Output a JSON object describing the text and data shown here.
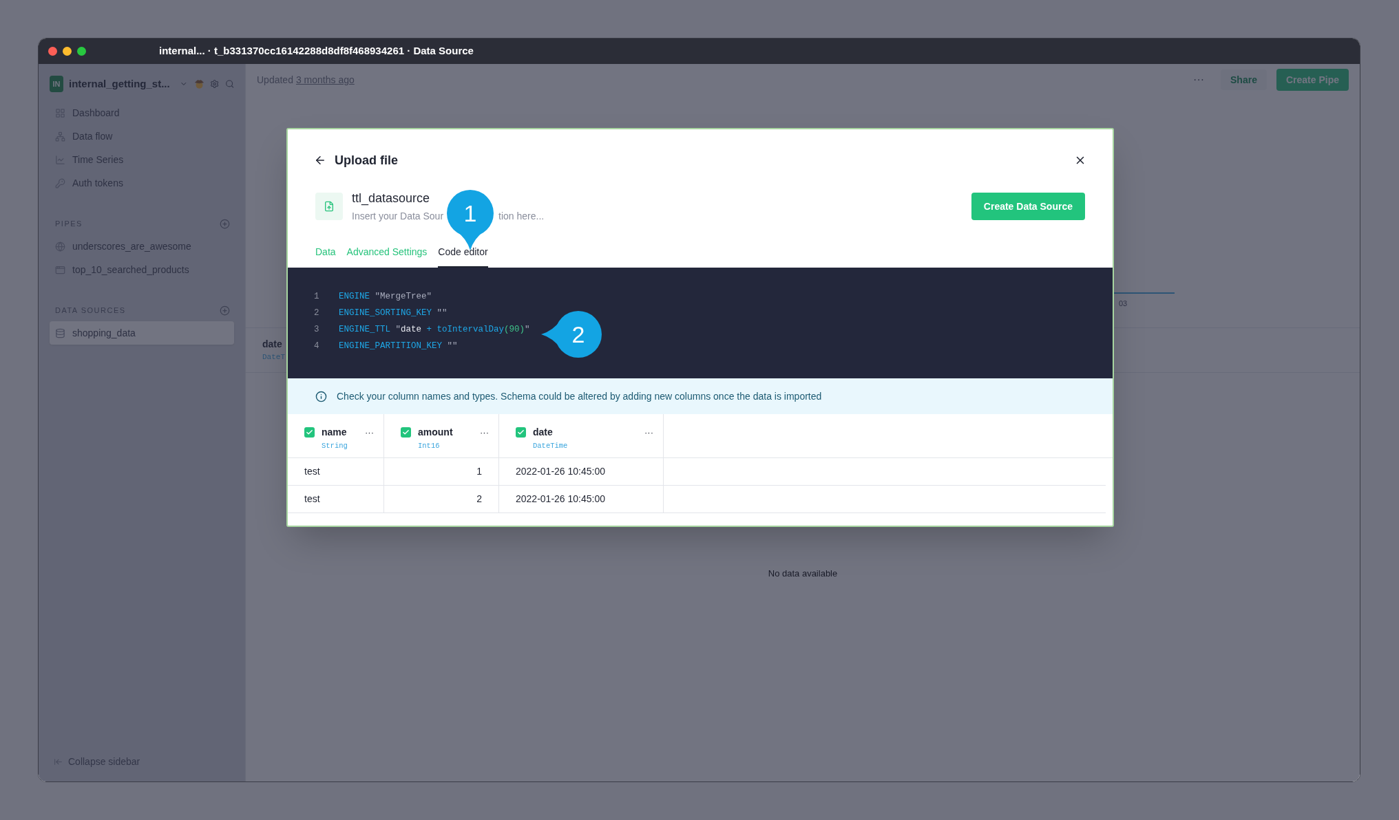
{
  "window": {
    "title": "internal... · t_b331370cc16142288d8df8f468934261 · Data Source"
  },
  "sidebar": {
    "workspace": {
      "initials": "IN",
      "name": "internal_getting_st..."
    },
    "nav": [
      {
        "label": "Dashboard",
        "kind": "dashboard"
      },
      {
        "label": "Data flow",
        "kind": "flow"
      },
      {
        "label": "Time Series",
        "kind": "chart"
      },
      {
        "label": "Auth tokens",
        "kind": "key"
      }
    ],
    "sections": [
      {
        "title": "PIPES",
        "items": [
          {
            "label": "underscores_are_awesome",
            "kind": "endpoint",
            "selected": false
          },
          {
            "label": "top_10_searched_products",
            "kind": "pipe",
            "selected": false
          }
        ]
      },
      {
        "title": "DATA SOURCES",
        "items": [
          {
            "label": "shopping_data",
            "kind": "datasource",
            "selected": true
          }
        ]
      }
    ],
    "collapse": "Collapse sidebar"
  },
  "topbar": {
    "updated": "Updated",
    "updated_link": "3 months ago",
    "more": "···",
    "share": "Share",
    "create_pipe": "Create Pipe"
  },
  "background": {
    "column_name": "date",
    "column_type": "DateT",
    "axis_label": "03",
    "empty": "No data available"
  },
  "modal": {
    "title": "Upload file",
    "name": "ttl_datasource",
    "description_parts": [
      "Insert your Data Sour",
      "tion here..."
    ],
    "create_button": "Create Data Source",
    "tabs": [
      {
        "label": "Data",
        "selected": false
      },
      {
        "label": "Advanced Settings",
        "selected": false
      },
      {
        "label": "Code editor",
        "selected": true
      }
    ],
    "code": [
      {
        "number": "1",
        "tokens": [
          {
            "text": "ENGINE",
            "kind": "keyword"
          },
          {
            "text": " \"MergeTree\"",
            "kind": "string"
          }
        ]
      },
      {
        "number": "2",
        "tokens": [
          {
            "text": "ENGINE_SORTING_KEY",
            "kind": "keyword"
          },
          {
            "text": " \"\"",
            "kind": "string"
          }
        ]
      },
      {
        "number": "3",
        "tokens": [
          {
            "text": "ENGINE_TTL",
            "kind": "keyword"
          },
          {
            "text": " \"",
            "kind": "string"
          },
          {
            "text": "date",
            "kind": "ident"
          },
          {
            "text": " + toIntervalDay",
            "kind": "function"
          },
          {
            "text": "(90)",
            "kind": "number"
          },
          {
            "text": "\"",
            "kind": "string"
          }
        ]
      },
      {
        "number": "4",
        "tokens": [
          {
            "text": "ENGINE_PARTITION_KEY",
            "kind": "keyword"
          },
          {
            "text": " \"\"",
            "kind": "string"
          }
        ]
      }
    ],
    "notice": "Check your column names and types. Schema could be altered by adding new columns once the data is imported",
    "columns": [
      {
        "name": "name",
        "type": "String",
        "checked": true,
        "menu": "···"
      },
      {
        "name": "amount",
        "type": "Int16",
        "checked": true,
        "menu": "···"
      },
      {
        "name": "date",
        "type": "DateTime",
        "checked": true,
        "menu": "···"
      }
    ],
    "rows": [
      [
        "test",
        "1",
        "2022-01-26 10:45:00"
      ],
      [
        "test",
        "2",
        "2022-01-26 10:45:00"
      ]
    ],
    "callouts": [
      {
        "label": "1",
        "kind": "down"
      },
      {
        "label": "2",
        "kind": "left"
      }
    ]
  }
}
